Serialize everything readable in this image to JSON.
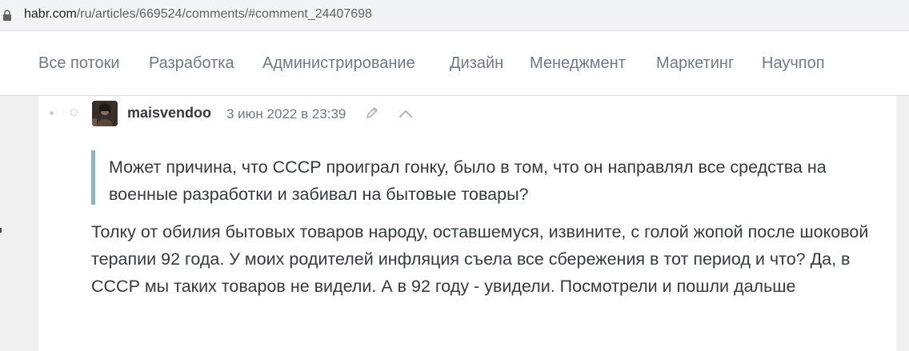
{
  "browser": {
    "url_host": "habr.com",
    "url_path": "/ru/articles/669524/comments/#comment_24407698"
  },
  "nav": {
    "items": [
      {
        "label": "Все потоки"
      },
      {
        "label": "Разработка"
      },
      {
        "label": "Администрирование"
      },
      {
        "label": "Дизайн"
      },
      {
        "label": "Менеджмент"
      },
      {
        "label": "Маркетинг"
      },
      {
        "label": "Научпоп"
      }
    ]
  },
  "comment": {
    "author": "maisvendoo",
    "date": "3 июн 2022 в 23:39",
    "quote": "Может причина, что СССР проиграл гонку, было в том, что он направлял все средства на военные разработки и забивал на бытовые товары?",
    "body": "Толку от обилия бытовых товаров народу, оставшемуся, извините, с голой жопой после шоковой терапии 92 года. У моих родителей инфляция съела все сбережения в тот период и что? Да, в СССР мы таких товаров не видели. А в 92 году - увидели. Посмотрели и пошли дальше"
  },
  "icons": [
    "lock-icon",
    "edit-icon",
    "chevron-up-icon"
  ],
  "colors": {
    "nav_text": "#6b7b86",
    "quote_border": "#8fb3bf",
    "text": "#333a3f"
  }
}
